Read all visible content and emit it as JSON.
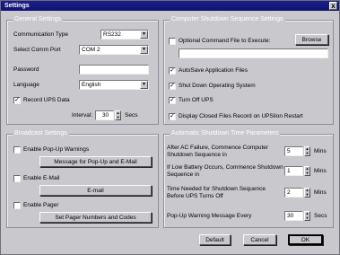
{
  "window": {
    "title": "Settings",
    "close": "x"
  },
  "general": {
    "title": "General Settings",
    "comm_type_label": "Communication Type",
    "comm_type_value": "RS232",
    "comm_port_label": "Select Comm Port",
    "comm_port_value": "COM 2",
    "password_label": "Password",
    "password_value": "",
    "language_label": "Language",
    "language_value": "English",
    "record_label": "Record UPS Data",
    "record_checked": "✓",
    "interval_label": "Interval:",
    "interval_value": "30",
    "interval_unit": "Secs"
  },
  "shutdown_sequence": {
    "title": "Computer Shutdown Sequence Settings",
    "optional_cmd_label": "Optional Command File to Execute:",
    "browse_label": "Browse",
    "cmd_value": "",
    "autosave_label": "AutoSave Application Files",
    "autosave_checked": "✓",
    "shutdown_os_label": "Shut Down Operating System",
    "shutdown_os_checked": "✓",
    "turnoff_label": "Turn Off UPS",
    "turnoff_checked": "✓",
    "display_closed_label": "Display Closed Files Record on UPSilon Restart",
    "display_closed_checked": "✓"
  },
  "broadcast": {
    "title": "Broadcast Settings",
    "popup_label": "Enable Pop-Up Warnings",
    "popup_btn": "Message for Pop-Up and E-Mail",
    "email_label": "Enable E-Mail",
    "email_btn": "E-mail",
    "pager_label": "Enable Pager",
    "pager_btn": "Set Pager Numbers and Codes"
  },
  "timing": {
    "title": "Automatic Shutdown Time Parameters",
    "ac_failure_label": "After AC Failure, Commence Computer Shutdown Sequence in",
    "ac_failure_value": "5",
    "ac_failure_unit": "Mins",
    "low_battery_label": "If Low Battery Occurs, Commence Shutdown Sequence in",
    "low_battery_value": "1",
    "low_battery_unit": "Mins",
    "needed_label": "Time Needed for Shutdown Sequence Before UPS Turns Off",
    "needed_value": "2",
    "needed_unit": "Mins",
    "popup_every_label": "Pop-Up Warning Message Every",
    "popup_every_value": "30",
    "popup_every_unit": "Secs"
  },
  "footer": {
    "default_label": "Default",
    "cancel_label": "Cancel",
    "ok_label": "OK"
  }
}
